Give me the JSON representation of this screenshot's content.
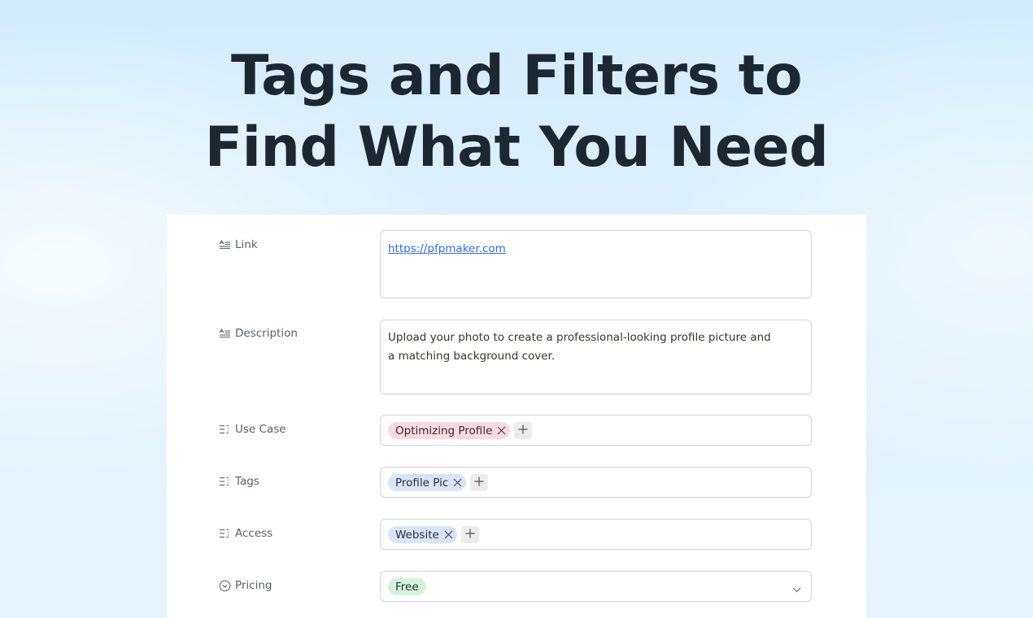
{
  "headline": {
    "line1": "Tags and Filters to",
    "line2": "Find What You Need"
  },
  "form": {
    "link": {
      "label": "Link",
      "icon": "text-lines-icon",
      "value": "https://pfpmaker.com"
    },
    "description": {
      "label": "Description",
      "icon": "text-lines-icon",
      "value": "Upload your photo to create a professional-looking profile picture and a matching background cover."
    },
    "use_case": {
      "label": "Use Case",
      "icon": "multi-select-icon",
      "tags": [
        "Optimizing Profile"
      ],
      "tag_color": "#fcd9df"
    },
    "tags": {
      "label": "Tags",
      "icon": "multi-select-icon",
      "tags": [
        "Profile Pic"
      ],
      "tag_color": "#d7e5fb"
    },
    "access": {
      "label": "Access",
      "icon": "multi-select-icon",
      "tags": [
        "Website"
      ],
      "tag_color": "#d7e5fb"
    },
    "pricing": {
      "label": "Pricing",
      "icon": "chevron-circle-icon",
      "value": "Free",
      "tag_color": "#d3f4d9"
    }
  }
}
